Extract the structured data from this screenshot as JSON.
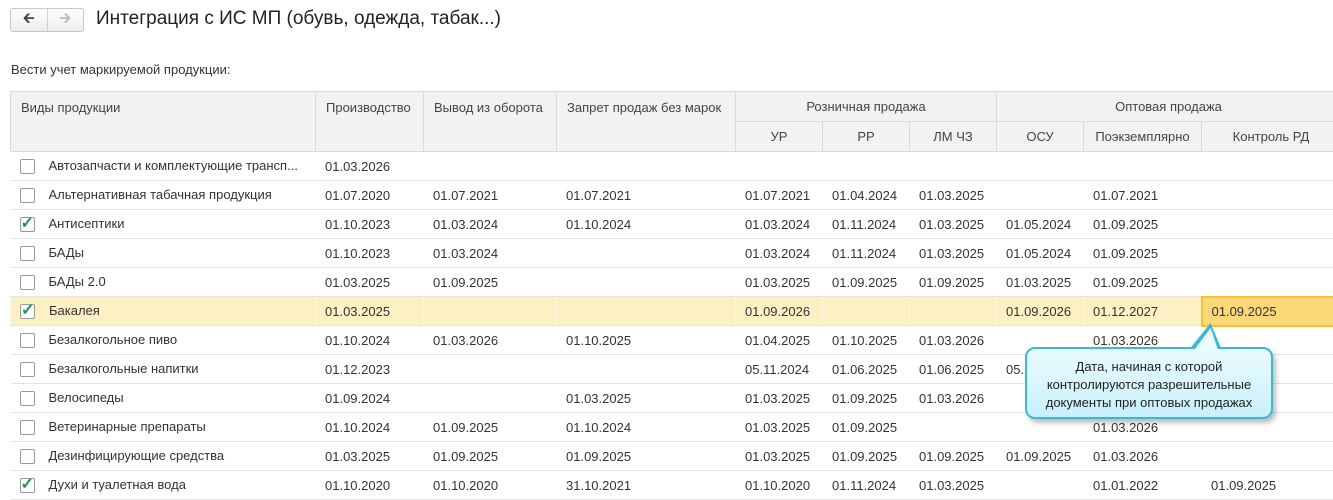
{
  "header": {
    "title": "Интеграция с ИС МП (обувь, одежда, табак...)",
    "back_icon": "arrow-left",
    "forward_icon": "arrow-right"
  },
  "section_label": "Вести учет маркируемой продукции:",
  "columns": {
    "kind": "Виды продукции",
    "production": "Производство",
    "withdrawal": "Вывод из оборота",
    "ban": "Запрет продаж без марок",
    "retail": "Розничная продажа",
    "ur": "УР",
    "rr": "РР",
    "lm": "ЛМ ЧЗ",
    "wholesale": "Оптовая продажа",
    "osu": "ОСУ",
    "per_item": "Поэкземплярно",
    "rd": "Контроль РД"
  },
  "rows": [
    {
      "checked": false,
      "name": "Автозапчасти и комплектующие трансп...",
      "v": [
        "01.03.2026",
        "",
        "",
        "",
        "",
        "",
        "",
        "",
        ""
      ]
    },
    {
      "checked": false,
      "name": "Альтернативная табачная продукция",
      "v": [
        "01.07.2020",
        "01.07.2021",
        "01.07.2021",
        "01.07.2021",
        "01.04.2024",
        "01.03.2025",
        "",
        "01.07.2021",
        ""
      ]
    },
    {
      "checked": true,
      "name": "Антисептики",
      "v": [
        "01.10.2023",
        "01.03.2024",
        "01.10.2024",
        "01.03.2024",
        "01.11.2024",
        "01.03.2025",
        "01.05.2024",
        "01.09.2025",
        ""
      ]
    },
    {
      "checked": false,
      "name": "БАДы",
      "v": [
        "01.10.2023",
        "01.03.2024",
        "",
        "01.03.2024",
        "01.11.2024",
        "01.03.2025",
        "01.05.2024",
        "01.09.2025",
        ""
      ]
    },
    {
      "checked": false,
      "name": "БАДы 2.0",
      "v": [
        "01.03.2025",
        "01.09.2025",
        "",
        "01.03.2025",
        "01.09.2025",
        "01.09.2025",
        "01.03.2025",
        "01.09.2025",
        ""
      ]
    },
    {
      "checked": true,
      "name": "Бакалея",
      "selected": true,
      "v": [
        "01.03.2025",
        "",
        "",
        "01.09.2026",
        "",
        "",
        "01.09.2026",
        "01.12.2027",
        "01.09.2025"
      ]
    },
    {
      "checked": false,
      "name": "Безалкогольное пиво",
      "v": [
        "01.10.2024",
        "01.03.2026",
        "01.10.2025",
        "01.04.2025",
        "01.10.2025",
        "01.03.2026",
        "",
        "01.03.2026",
        ""
      ]
    },
    {
      "checked": false,
      "name": "Безалкогольные напитки",
      "v": [
        "01.12.2023",
        "",
        "",
        "05.11.2024",
        "01.06.2025",
        "01.06.2025",
        "05.",
        "",
        ""
      ]
    },
    {
      "checked": false,
      "name": "Велосипеды",
      "v": [
        "01.09.2024",
        "",
        "01.03.2025",
        "01.03.2025",
        "01.09.2025",
        "01.03.2026",
        "",
        "",
        ""
      ]
    },
    {
      "checked": false,
      "name": "Ветеринарные препараты",
      "v": [
        "01.10.2024",
        "01.09.2025",
        "01.10.2024",
        "01.03.2025",
        "01.09.2025",
        "",
        "",
        "01.03.2026",
        ""
      ]
    },
    {
      "checked": false,
      "name": "Дезинфицирующие средства",
      "v": [
        "01.03.2025",
        "01.09.2025",
        "01.09.2025",
        "01.03.2025",
        "01.09.2025",
        "01.09.2025",
        "01.09.2025",
        "01.03.2026",
        ""
      ]
    },
    {
      "checked": true,
      "name": "Духи и туалетная вода",
      "v": [
        "01.10.2020",
        "01.10.2020",
        "31.10.2021",
        "01.10.2020",
        "01.11.2024",
        "01.03.2025",
        "",
        "01.01.2022",
        "01.09.2025"
      ]
    }
  ],
  "tooltip": "Дата, начиная с которой контролируются разрешительные документы при оптовых продажах",
  "colors": {
    "selected_row": "#fdf0c3",
    "current_cell": "#fbd978",
    "check": "#1a9a4a",
    "tooltip_border": "#3fb7cf"
  }
}
